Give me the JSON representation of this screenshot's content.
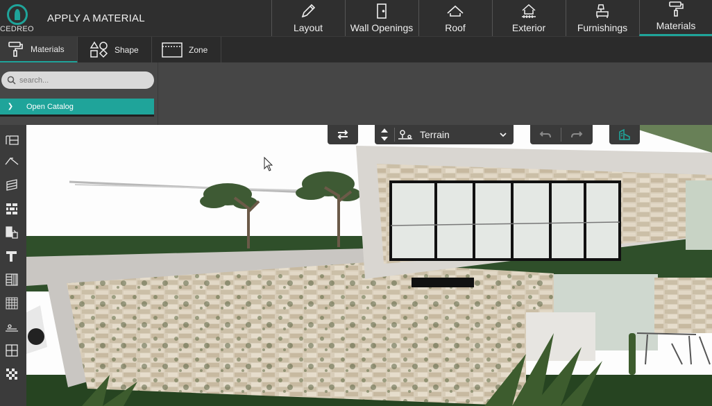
{
  "app": {
    "brand": "CEDREO",
    "title": "APPLY A MATERIAL"
  },
  "nav": {
    "items": [
      {
        "label": "Layout",
        "icon": "pencil-icon"
      },
      {
        "label": "Wall Openings",
        "icon": "door-icon"
      },
      {
        "label": "Roof",
        "icon": "roof-icon"
      },
      {
        "label": "Exterior",
        "icon": "exterior-icon"
      },
      {
        "label": "Furnishings",
        "icon": "furnishings-icon"
      },
      {
        "label": "Materials",
        "icon": "paint-roller-icon",
        "active": true
      }
    ]
  },
  "subtabs": {
    "materials": "Materials",
    "shape": "Shape",
    "zone": "Zone"
  },
  "panel": {
    "search_placeholder": "search...",
    "open_catalog": "Open Catalog"
  },
  "viewport_toolbar": {
    "terrain_label": "Terrain"
  },
  "colors": {
    "accent": "#1fa49a",
    "topbar": "#2f2f2f",
    "panel": "#464646"
  }
}
